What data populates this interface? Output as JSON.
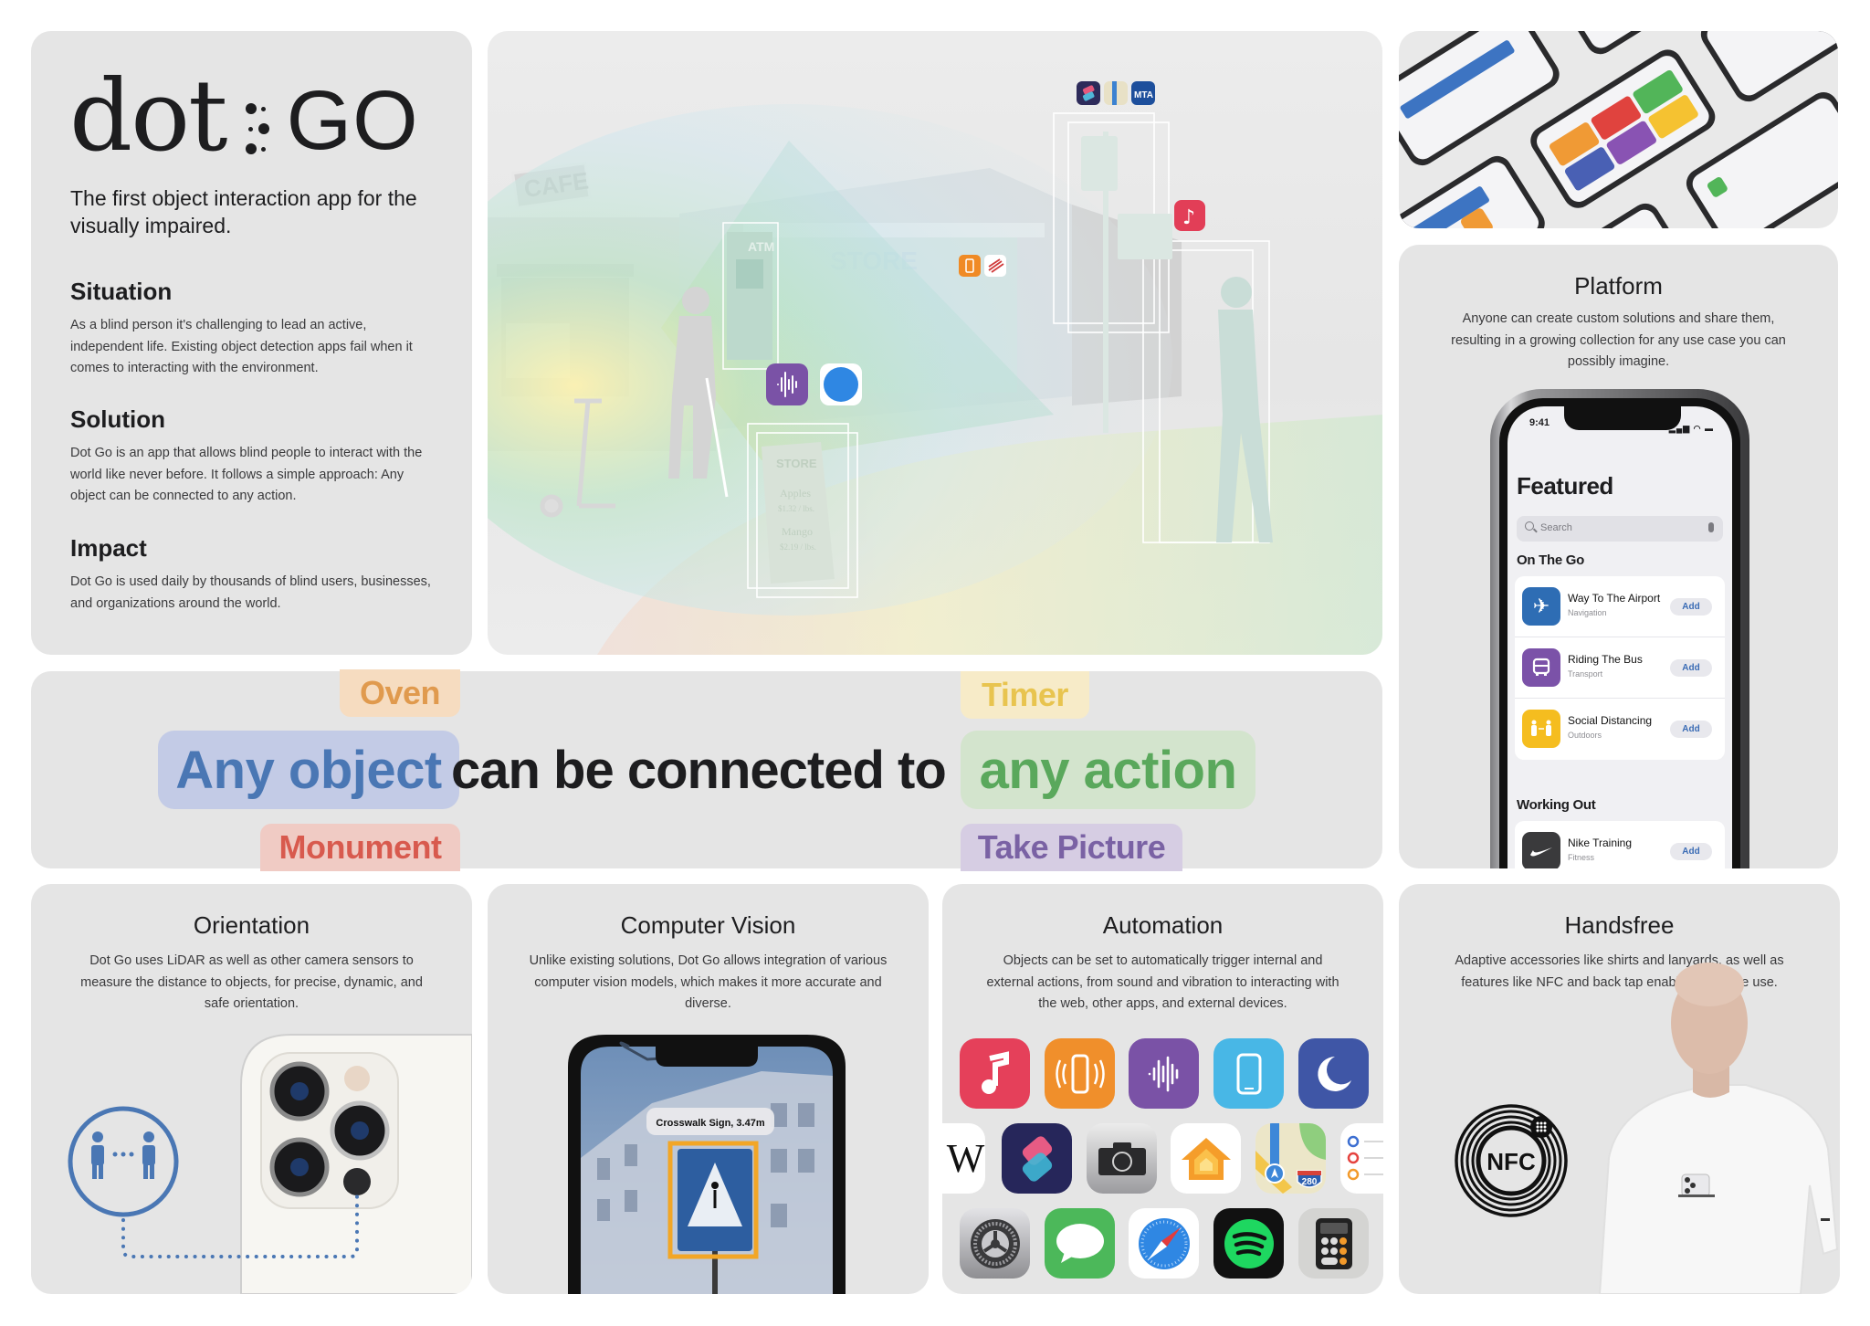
{
  "intro": {
    "logo_word": "dot",
    "logo_brand": "GO",
    "tagline": "The first object interaction app for the visually impaired.",
    "sections": [
      {
        "title": "Situation",
        "body": "As a blind person it's challenging to lead an active, independent life. Existing object detection apps fail when it comes to interacting with the environment."
      },
      {
        "title": "Solution",
        "body": "Dot Go is an app that allows blind people to interact with the world like never before. It follows a simple approach: Any object can be connected to any action."
      },
      {
        "title": "Impact",
        "body": "Dot Go is used daily by thousands of blind users, businesses, and organizations around the world."
      }
    ]
  },
  "hero": {
    "signs": {
      "cafe": "CAFE",
      "store": "STORE",
      "atm": "ATM",
      "board_title": "STORE",
      "board_line1": "Apples",
      "board_line2": "$1.32 / lbs.",
      "board_line3": "Mango",
      "board_line4": "$2.19 / lbs."
    },
    "icons": [
      "shortcuts-icon",
      "maps-icon",
      "mta-icon",
      "vibration-icon",
      "bank-icon",
      "music-icon",
      "voice-memo-icon",
      "safari-icon"
    ],
    "mta_label": "MTA"
  },
  "platform": {
    "title": "Platform",
    "description": "Anyone can create custom solutions and share them, resulting in a growing collection for any use case you can possibly imagine.",
    "phone": {
      "time": "9:41",
      "heading": "Featured",
      "search_placeholder": "Search",
      "groups": [
        {
          "title": "On The Go",
          "items": [
            {
              "name": "Way To The Airport",
              "category": "Navigation",
              "icon": "airplane-icon",
              "color": "#2e6db4",
              "action": "Add"
            },
            {
              "name": "Riding The Bus",
              "category": "Transport",
              "icon": "bus-icon",
              "color": "#7b52a8",
              "action": "Add"
            },
            {
              "name": "Social Distancing",
              "category": "Outdoors",
              "icon": "social-distancing-icon",
              "color": "#f5bd1f",
              "action": "Add"
            }
          ]
        },
        {
          "title": "Working Out",
          "items": [
            {
              "name": "Nike Training",
              "category": "Fitness",
              "icon": "nike-icon",
              "color": "#3a3a3c",
              "action": "Add"
            }
          ]
        }
      ]
    }
  },
  "band": {
    "subject": "Any object",
    "connector": "can be connected to",
    "predicate": "any action",
    "object_examples": [
      "Oven",
      "Monument"
    ],
    "action_examples": [
      "Timer",
      "Take Picture"
    ],
    "colors": {
      "subject_bg": "#c3cbe6",
      "subject_fg": "#4a77b4",
      "predicate_bg": "#d3e4cd",
      "predicate_fg": "#5aa85c",
      "oven_bg": "#f6dcc0",
      "oven_fg": "#e09a4e",
      "monument_bg": "#f0cbc4",
      "monument_fg": "#d85a4e",
      "timer_bg": "#f7ebc8",
      "timer_fg": "#e8c44f",
      "picture_bg": "#d6cde3",
      "picture_fg": "#7a62a4"
    }
  },
  "features": [
    {
      "title": "Orientation",
      "description": "Dot Go uses LiDAR as well as other camera sensors to measure the distance to objects, for precise, dynamic, and safe orientation."
    },
    {
      "title": "Computer Vision",
      "description": "Unlike existing solutions, Dot Go allows integration of various computer vision models, which makes it more accurate and diverse.",
      "detection_label": "Crosswalk Sign, 3.47m"
    },
    {
      "title": "Automation",
      "description": "Objects can be set to automatically trigger internal and external actions, from sound and vibration to interacting with the web, other apps, and external devices.",
      "apps": [
        [
          "music-icon",
          "vibration-icon",
          "voice-memo-icon",
          "phone-screen-icon",
          "moon-icon"
        ],
        [
          "wikipedia-icon",
          "shortcuts-icon",
          "camera-icon",
          "home-icon",
          "maps-icon",
          "reminders-icon"
        ],
        [
          "settings-icon",
          "messages-icon",
          "safari-icon",
          "spotify-icon",
          "calculator-icon"
        ]
      ],
      "maps_shield": "280",
      "wiki_letter": "W"
    },
    {
      "title": "Handsfree",
      "description": "Adaptive accessories like shirts and lanyards, as well as features like NFC and back tap enable handsfree use.",
      "nfc_label": "NFC"
    }
  ],
  "colors": {
    "card_bg": "#e5e5e5",
    "page_bg": "#ffffff",
    "accent_blue": "#4a77b4"
  }
}
